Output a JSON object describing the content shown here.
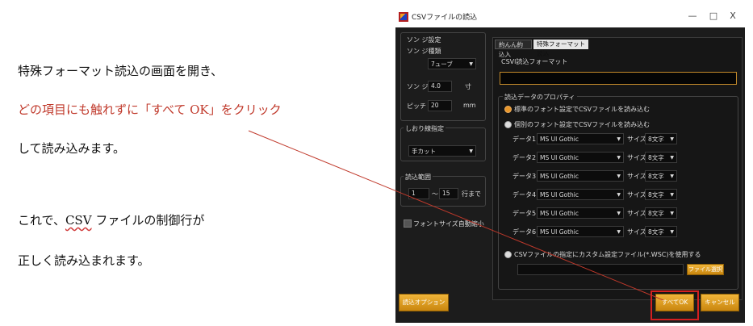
{
  "doc": {
    "line1": "特殊フォーマット読込の画面を開き、",
    "line2": "どの項目にも触れずに「すべて OK」をクリック",
    "line3": "して読み込みます。",
    "line4_pre": "これで、",
    "line4_csv": "CSV",
    "line4_post": " ファイルの制御行が",
    "line5": "正しく読み込まれます。"
  },
  "window": {
    "title": "CSVファイルの読込",
    "minimize": "—",
    "maximize": "□",
    "close": "X"
  },
  "left_panel": {
    "paper_settings": "ソン ジ設定",
    "paper_type_label": "ソン ジ種類",
    "paper_type_value": "7ューブ",
    "width_label": "ソン ジ幅",
    "width_value": "4.0",
    "width_unit": "寸",
    "pitch_label": "ピッチ",
    "pitch_value": "20",
    "pitch_unit": "mm",
    "trim_group": "しおり線指定",
    "trim_value": "手カット",
    "range_group": "読込範囲",
    "range_from": "1",
    "range_sep": "〜",
    "range_to": "15",
    "range_unit": "行まで",
    "auto_font": "フォントサイズ自動縮小",
    "options_button": "読込オプション"
  },
  "tabs": [
    {
      "label": "約んん約込入"
    },
    {
      "label": "特殊フォーマット読込"
    }
  ],
  "right_panel": {
    "csv_format_label": "CSVl読込フォーマット",
    "csv_format_value": "",
    "property_group": "読込データのプロパティ",
    "radio1": "標準のフォント設定でCSVファイルを読み込む",
    "radio2": "個別のフォント設定でCSVファイルを読み込む",
    "size_label": "サイズ",
    "rows": [
      {
        "label": "データ1",
        "font": "MS UI Gothic",
        "size": "8文字"
      },
      {
        "label": "データ2",
        "font": "MS UI Gothic",
        "size": "8文字"
      },
      {
        "label": "データ3",
        "font": "MS UI Gothic",
        "size": "8文字"
      },
      {
        "label": "データ4",
        "font": "MS UI Gothic",
        "size": "8文字"
      },
      {
        "label": "データ5",
        "font": "MS UI Gothic",
        "size": "8文字"
      },
      {
        "label": "データ6",
        "font": "MS UI Gothic",
        "size": "8文字"
      }
    ],
    "radio3": "CSVファイルの指定にカスタム設定ファイル(*.WSC)を使用する",
    "custom_path": "",
    "file_select_button": "ファイル選択"
  },
  "footer": {
    "ok_button": "すべてOK",
    "cancel_button": "キャンセル"
  },
  "colors": {
    "annotation_red": "#c0392b",
    "dialog_bg": "#1c1c1c",
    "gold_button": "#e0a020"
  }
}
